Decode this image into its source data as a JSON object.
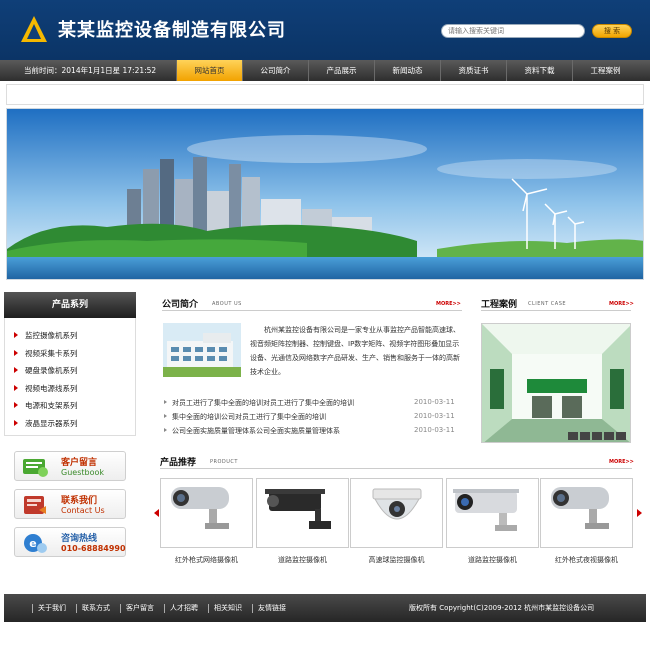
{
  "header": {
    "company_name": "某某监控设备制造有限公司",
    "search_placeholder": "请输入搜索关键词",
    "search_button": "搜 索"
  },
  "nav": {
    "time": "当前时间：2014年1月1日星 17:21:52",
    "items": [
      "网站首页",
      "公司简介",
      "产品展示",
      "新闻动态",
      "资质证书",
      "资料下载",
      "工程案例"
    ]
  },
  "sidebar": {
    "title": "产品系列",
    "items": [
      "监控摄像机系列",
      "视频采集卡系列",
      "硬盘录像机系列",
      "视频电源线系列",
      "电源和支架系列",
      "液晶显示器系列"
    ],
    "buttons": [
      {
        "title": "客户留言",
        "sub": "Guestbook"
      },
      {
        "title": "联系我们",
        "sub": "Contact Us"
      },
      {
        "title": "咨询热线",
        "sub": "010-68884990"
      }
    ]
  },
  "about": {
    "title": "公司简介",
    "subtitle": "ABOUT US",
    "more": "MORE>>",
    "text": "杭州某监控设备有限公司是一家专业从事监控产品智能高速球、视音频矩阵控制器、控制键盘、IP数字矩阵、视频字符图形叠加显示设备、光通信及网络数字产品研发、生产、销售和服务于一体的高新技术企业。"
  },
  "news": [
    {
      "title": "对员工进行了集中全面的培训对员工进行了集中全面的培训",
      "date": "2010-03-11"
    },
    {
      "title": "集中全面的培训公司对员工进行了集中全面的培训",
      "date": "2010-03-11"
    },
    {
      "title": "公司全面实施质量管理体系公司全面实施质量管理体系",
      "date": "2010-03-11"
    }
  ],
  "cases": {
    "title": "工程案例",
    "subtitle": "CLIENT CASE",
    "more": "MORE>>"
  },
  "products": {
    "title": "产品推荐",
    "subtitle": "PRODUCT",
    "more": "MORE>>",
    "items": [
      "红外枪式网络摄像机",
      "道路监控摄像机",
      "高速球监控摄像机",
      "道路监控摄像机",
      "红外枪式夜视摄像机"
    ]
  },
  "footer": {
    "links": [
      "关于我们",
      "联系方式",
      "客户留言",
      "人才招聘",
      "相关知识",
      "友情链接"
    ],
    "copyright": "版权所有 Copyright(C)2009-2012 杭州市某监控设备公司"
  },
  "colors": {
    "header_blue": "#0f3f78",
    "accent_orange": "#f2a200",
    "nav_dark": "#3a3a3a"
  }
}
